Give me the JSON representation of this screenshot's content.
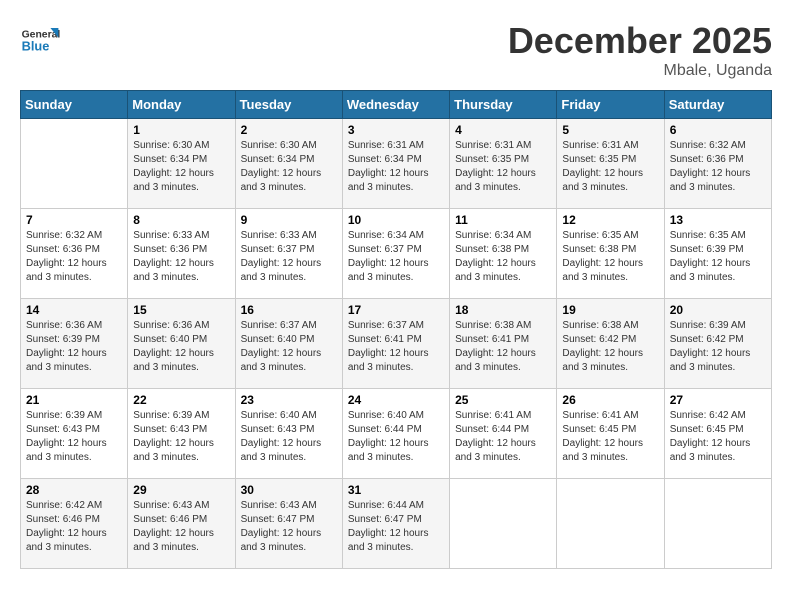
{
  "header": {
    "logo_general": "General",
    "logo_blue": "Blue",
    "month_title": "December 2025",
    "location": "Mbale, Uganda"
  },
  "days_of_week": [
    "Sunday",
    "Monday",
    "Tuesday",
    "Wednesday",
    "Thursday",
    "Friday",
    "Saturday"
  ],
  "weeks": [
    [
      {
        "day": "",
        "info": ""
      },
      {
        "day": "1",
        "info": "Sunrise: 6:30 AM\nSunset: 6:34 PM\nDaylight: 12 hours\nand 3 minutes."
      },
      {
        "day": "2",
        "info": "Sunrise: 6:30 AM\nSunset: 6:34 PM\nDaylight: 12 hours\nand 3 minutes."
      },
      {
        "day": "3",
        "info": "Sunrise: 6:31 AM\nSunset: 6:34 PM\nDaylight: 12 hours\nand 3 minutes."
      },
      {
        "day": "4",
        "info": "Sunrise: 6:31 AM\nSunset: 6:35 PM\nDaylight: 12 hours\nand 3 minutes."
      },
      {
        "day": "5",
        "info": "Sunrise: 6:31 AM\nSunset: 6:35 PM\nDaylight: 12 hours\nand 3 minutes."
      },
      {
        "day": "6",
        "info": "Sunrise: 6:32 AM\nSunset: 6:36 PM\nDaylight: 12 hours\nand 3 minutes."
      }
    ],
    [
      {
        "day": "7",
        "info": "Sunrise: 6:32 AM\nSunset: 6:36 PM\nDaylight: 12 hours\nand 3 minutes."
      },
      {
        "day": "8",
        "info": "Sunrise: 6:33 AM\nSunset: 6:36 PM\nDaylight: 12 hours\nand 3 minutes."
      },
      {
        "day": "9",
        "info": "Sunrise: 6:33 AM\nSunset: 6:37 PM\nDaylight: 12 hours\nand 3 minutes."
      },
      {
        "day": "10",
        "info": "Sunrise: 6:34 AM\nSunset: 6:37 PM\nDaylight: 12 hours\nand 3 minutes."
      },
      {
        "day": "11",
        "info": "Sunrise: 6:34 AM\nSunset: 6:38 PM\nDaylight: 12 hours\nand 3 minutes."
      },
      {
        "day": "12",
        "info": "Sunrise: 6:35 AM\nSunset: 6:38 PM\nDaylight: 12 hours\nand 3 minutes."
      },
      {
        "day": "13",
        "info": "Sunrise: 6:35 AM\nSunset: 6:39 PM\nDaylight: 12 hours\nand 3 minutes."
      }
    ],
    [
      {
        "day": "14",
        "info": "Sunrise: 6:36 AM\nSunset: 6:39 PM\nDaylight: 12 hours\nand 3 minutes."
      },
      {
        "day": "15",
        "info": "Sunrise: 6:36 AM\nSunset: 6:40 PM\nDaylight: 12 hours\nand 3 minutes."
      },
      {
        "day": "16",
        "info": "Sunrise: 6:37 AM\nSunset: 6:40 PM\nDaylight: 12 hours\nand 3 minutes."
      },
      {
        "day": "17",
        "info": "Sunrise: 6:37 AM\nSunset: 6:41 PM\nDaylight: 12 hours\nand 3 minutes."
      },
      {
        "day": "18",
        "info": "Sunrise: 6:38 AM\nSunset: 6:41 PM\nDaylight: 12 hours\nand 3 minutes."
      },
      {
        "day": "19",
        "info": "Sunrise: 6:38 AM\nSunset: 6:42 PM\nDaylight: 12 hours\nand 3 minutes."
      },
      {
        "day": "20",
        "info": "Sunrise: 6:39 AM\nSunset: 6:42 PM\nDaylight: 12 hours\nand 3 minutes."
      }
    ],
    [
      {
        "day": "21",
        "info": "Sunrise: 6:39 AM\nSunset: 6:43 PM\nDaylight: 12 hours\nand 3 minutes."
      },
      {
        "day": "22",
        "info": "Sunrise: 6:39 AM\nSunset: 6:43 PM\nDaylight: 12 hours\nand 3 minutes."
      },
      {
        "day": "23",
        "info": "Sunrise: 6:40 AM\nSunset: 6:43 PM\nDaylight: 12 hours\nand 3 minutes."
      },
      {
        "day": "24",
        "info": "Sunrise: 6:40 AM\nSunset: 6:44 PM\nDaylight: 12 hours\nand 3 minutes."
      },
      {
        "day": "25",
        "info": "Sunrise: 6:41 AM\nSunset: 6:44 PM\nDaylight: 12 hours\nand 3 minutes."
      },
      {
        "day": "26",
        "info": "Sunrise: 6:41 AM\nSunset: 6:45 PM\nDaylight: 12 hours\nand 3 minutes."
      },
      {
        "day": "27",
        "info": "Sunrise: 6:42 AM\nSunset: 6:45 PM\nDaylight: 12 hours\nand 3 minutes."
      }
    ],
    [
      {
        "day": "28",
        "info": "Sunrise: 6:42 AM\nSunset: 6:46 PM\nDaylight: 12 hours\nand 3 minutes."
      },
      {
        "day": "29",
        "info": "Sunrise: 6:43 AM\nSunset: 6:46 PM\nDaylight: 12 hours\nand 3 minutes."
      },
      {
        "day": "30",
        "info": "Sunrise: 6:43 AM\nSunset: 6:47 PM\nDaylight: 12 hours\nand 3 minutes."
      },
      {
        "day": "31",
        "info": "Sunrise: 6:44 AM\nSunset: 6:47 PM\nDaylight: 12 hours\nand 3 minutes."
      },
      {
        "day": "",
        "info": ""
      },
      {
        "day": "",
        "info": ""
      },
      {
        "day": "",
        "info": ""
      }
    ]
  ]
}
